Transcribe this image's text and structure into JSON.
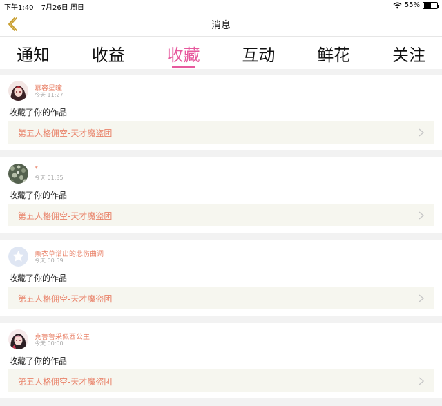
{
  "status": {
    "time": "下午1:40",
    "date": "7月26日 周日",
    "battery": "55%",
    "battery_level": 0.55
  },
  "header": {
    "title": "消息"
  },
  "tabs": [
    {
      "label": "通知",
      "active": false
    },
    {
      "label": "收益",
      "active": false
    },
    {
      "label": "收藏",
      "active": true
    },
    {
      "label": "互动",
      "active": false
    },
    {
      "label": "鲜花",
      "active": false
    },
    {
      "label": "关注",
      "active": false
    }
  ],
  "colors": {
    "accent": "#e75a9e",
    "username": "#e9836a",
    "work_bg": "#f6f6ef"
  },
  "items": [
    {
      "username": "慕容星曈",
      "time": "今天 11:27",
      "action": "收藏了你的作品",
      "work": "第五人格佣空-天才魔盗团",
      "avatar": "anime-avatar-red"
    },
    {
      "username": "*",
      "time": "今天 01:35",
      "action": "收藏了你的作品",
      "work": "第五人格佣空-天才魔盗团",
      "avatar": "green-pattern-avatar"
    },
    {
      "username": "薰衣草谱出的悲伤曲调",
      "time": "今天 00:59",
      "action": "收藏了你的作品",
      "work": "第五人格佣空-天才魔盗团",
      "avatar": "default-star-avatar"
    },
    {
      "username": "克鲁鲁采佩西公主",
      "time": "今天 00:00",
      "action": "收藏了你的作品",
      "work": "第五人格佣空-天才魔盗团",
      "avatar": "anime-avatar-pink"
    }
  ]
}
